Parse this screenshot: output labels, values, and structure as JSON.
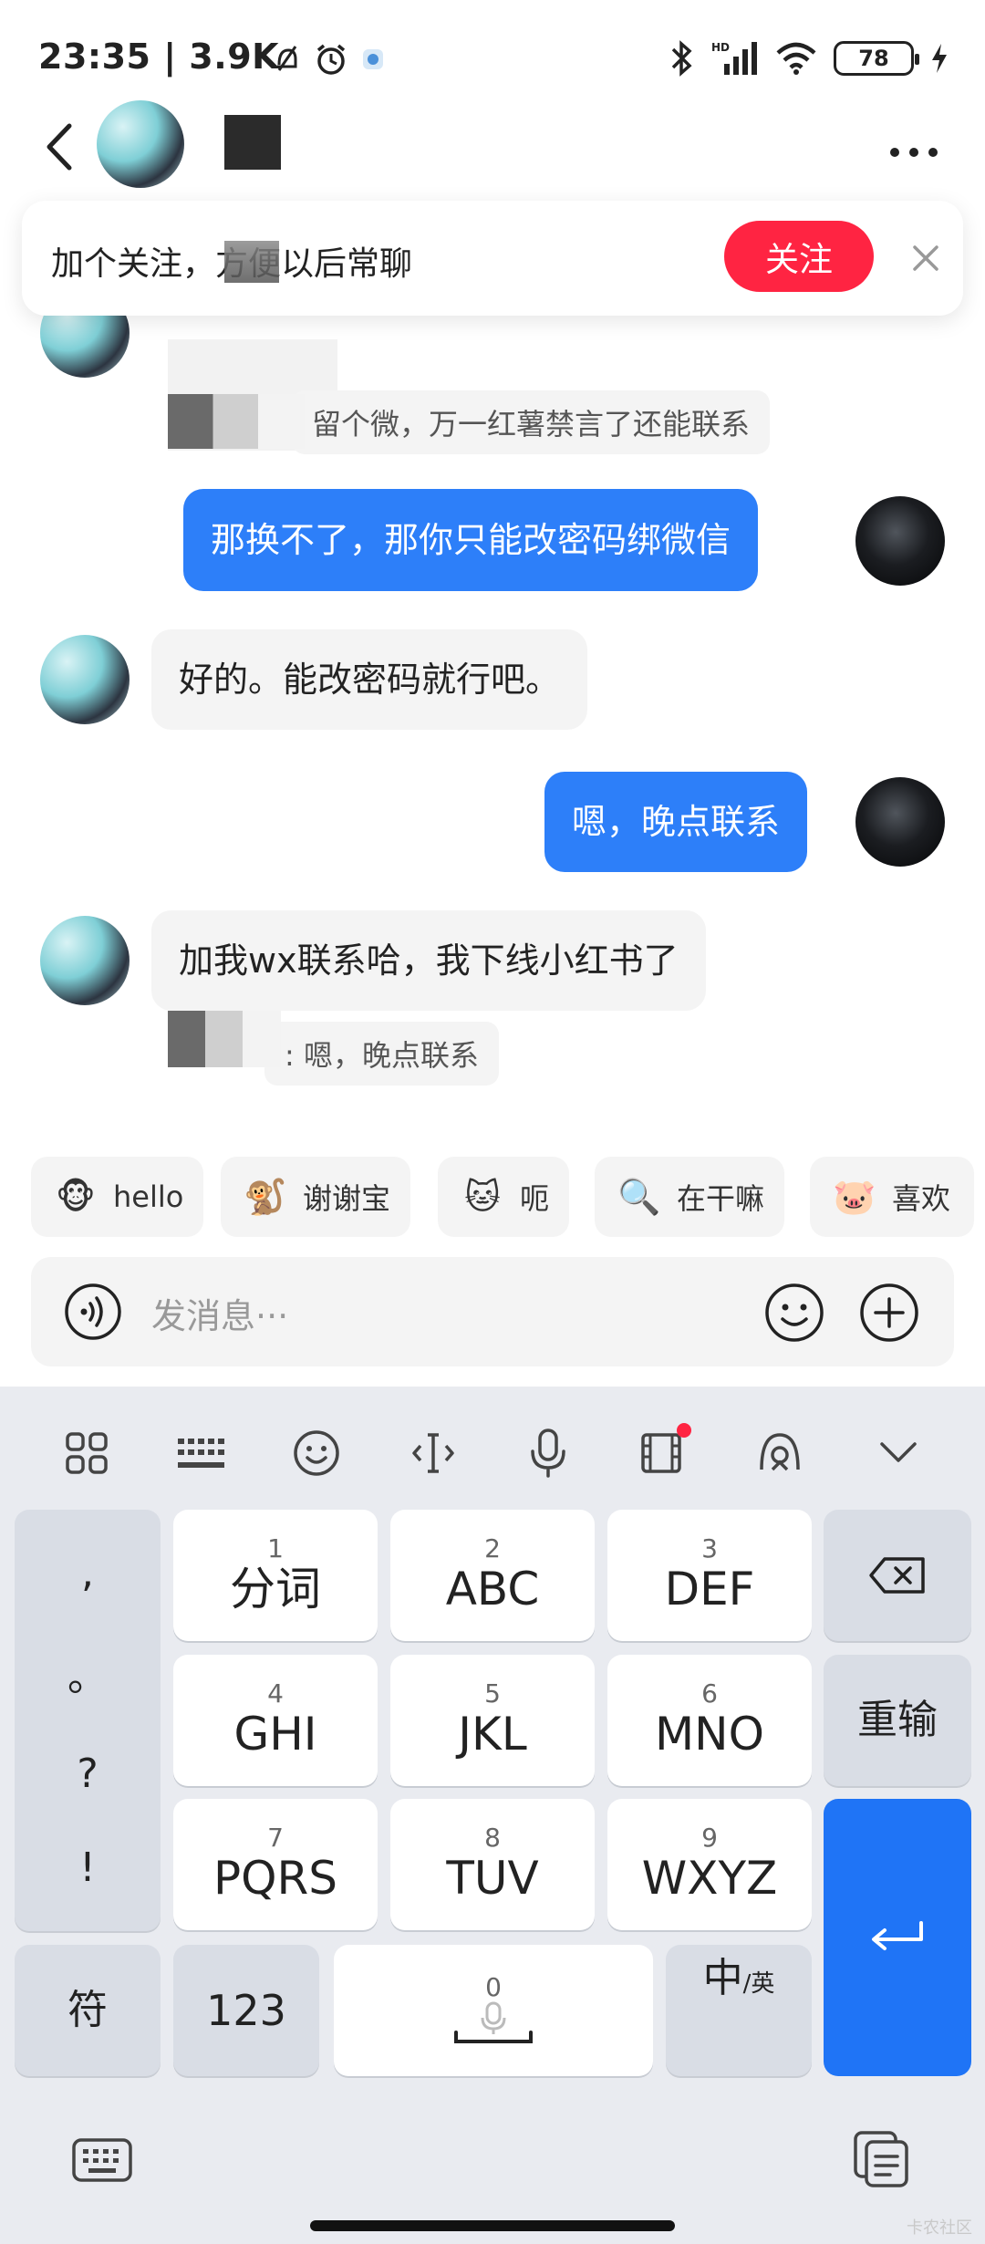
{
  "status_bar": {
    "time": "23:35",
    "speed": "| 3.9K",
    "battery": "78"
  },
  "header": {
    "back_icon": "chevron-left-icon",
    "more_icon": "more-dots-icon"
  },
  "follow_banner": {
    "text": "加个关注，方便以后常聊",
    "button": "关注",
    "colors": {
      "accent": "#ff2442"
    }
  },
  "messages": [
    {
      "from": "other",
      "quote": "留个微，万一红薯禁言了还能联系"
    },
    {
      "from": "me",
      "text": "那换不了，那你只能改密码绑微信"
    },
    {
      "from": "other",
      "text": "好的。能改密码就行吧。"
    },
    {
      "from": "me",
      "text": "嗯，晚点联系"
    },
    {
      "from": "other",
      "text": "加我wx联系哈，我下线小红书了",
      "quote": ": 嗯，晚点联系"
    }
  ],
  "quick_replies": [
    {
      "emoji": "🐵",
      "label": "hello"
    },
    {
      "emoji": "🐒",
      "label": "谢谢宝"
    },
    {
      "emoji": "🐱",
      "label": "呃"
    },
    {
      "emoji": "🔍",
      "label": "在干嘛"
    },
    {
      "emoji": "🐷",
      "label": "喜欢"
    }
  ],
  "input": {
    "placeholder": "发消息···"
  },
  "keyboard": {
    "punctuation": [
      ",",
      "。",
      "?",
      "!"
    ],
    "keys": [
      {
        "num": "1",
        "label": "分词"
      },
      {
        "num": "2",
        "label": "ABC"
      },
      {
        "num": "3",
        "label": "DEF"
      },
      {
        "num": "4",
        "label": "GHI"
      },
      {
        "num": "5",
        "label": "JKL"
      },
      {
        "num": "6",
        "label": "MNO"
      },
      {
        "num": "7",
        "label": "PQRS"
      },
      {
        "num": "8",
        "label": "TUV"
      },
      {
        "num": "9",
        "label": "WXYZ"
      }
    ],
    "retype": "重输",
    "symbols": "符",
    "numbers": "123",
    "space_num": "0",
    "lang_main": "中",
    "lang_alt": "/英",
    "colors": {
      "enter": "#1f74f6",
      "background": "#e9ebf0"
    }
  },
  "watermark": "卡农社区"
}
